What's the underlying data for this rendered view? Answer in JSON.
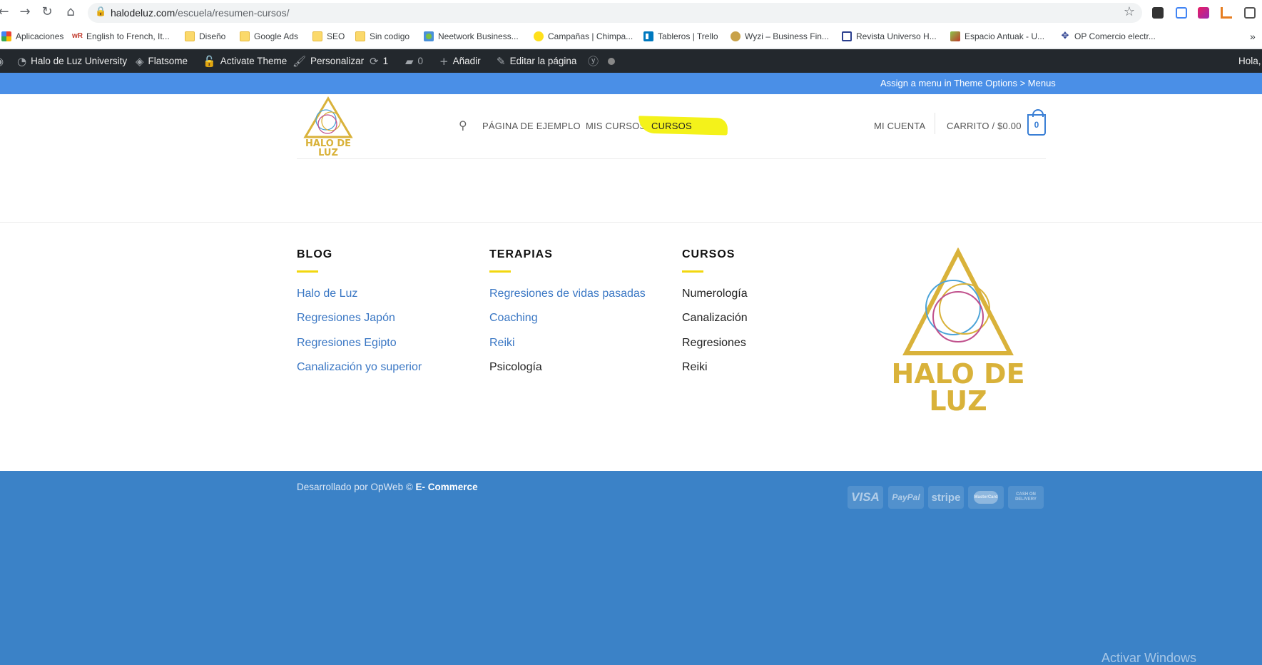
{
  "browser": {
    "url_domain": "halodeluz.com",
    "url_path": "/escuela/resumen-cursos/"
  },
  "bookmarks": [
    {
      "label": "Aplicaciones",
      "icon": "apps-grid-icon"
    },
    {
      "label": "English to French, It...",
      "icon": "wordreference-icon"
    },
    {
      "label": "Diseño",
      "icon": "folder-icon"
    },
    {
      "label": "Google Ads",
      "icon": "folder-icon"
    },
    {
      "label": "SEO",
      "icon": "folder-icon"
    },
    {
      "label": "Sin codigo",
      "icon": "folder-icon"
    },
    {
      "label": "Neetwork Business...",
      "icon": "neetwork-icon"
    },
    {
      "label": "Campañas | Chimpa...",
      "icon": "mailchimp-icon"
    },
    {
      "label": "Tableros | Trello",
      "icon": "trello-icon"
    },
    {
      "label": "Wyzi – Business Fin...",
      "icon": "wordpress-icon"
    },
    {
      "label": "Revista Universo H...",
      "icon": "page-icon"
    },
    {
      "label": "Espacio Antuak - U...",
      "icon": "leaf-icon"
    },
    {
      "label": "OP Comercio electr...",
      "icon": "move-icon"
    }
  ],
  "wp_admin_bar": {
    "site_name": "Halo de Luz University",
    "theme": "Flatsome",
    "activate": "Activate Theme",
    "customize": "Personalizar",
    "updates_count": "1",
    "comments_count": "0",
    "add_new": "Añadir",
    "edit_page": "Editar la página",
    "greeting": "Hola,"
  },
  "top_strip": {
    "text": "Assign a menu in Theme Options > Menus"
  },
  "header": {
    "logo_text_line1": "HALO DE",
    "logo_text_line2": "LUZ",
    "nav": [
      "PÁGINA DE EJEMPLO",
      "MIS CURSOS",
      "CURSOS"
    ],
    "account": "MI CUENTA",
    "cart": "CARRITO / $0.00",
    "cart_count": "0",
    "highlight_color": "#f4f21a"
  },
  "footer": {
    "columns": [
      {
        "title": "BLOG",
        "links": [
          "Halo de Luz",
          "Regresiones Japón",
          "Regresiones Egipto",
          "Canalización yo superior"
        ]
      },
      {
        "title": "TERAPIAS",
        "links": [
          "Regresiones de vidas pasadas",
          "Coaching",
          "Reiki",
          "Psicología"
        ]
      },
      {
        "title": "CURSOS",
        "links": [
          "Numerología",
          "Canalización",
          "Regresiones",
          "Reiki"
        ]
      }
    ],
    "logo_text_line1": "HALO DE",
    "logo_text_line2": "LUZ",
    "copyright_prefix": "Desarrollado por OpWeb ©",
    "copyright_brand": "E- Commerce",
    "payments": [
      "VISA",
      "PayPal",
      "stripe",
      "MasterCard",
      "CASH ON DELIVERY"
    ],
    "watermark": "Activar Windows"
  },
  "colors": {
    "accent_blue": "#3b82c7",
    "link_blue": "#3a77c4",
    "gold": "#d9b23a",
    "wp_bar": "#23282d"
  }
}
